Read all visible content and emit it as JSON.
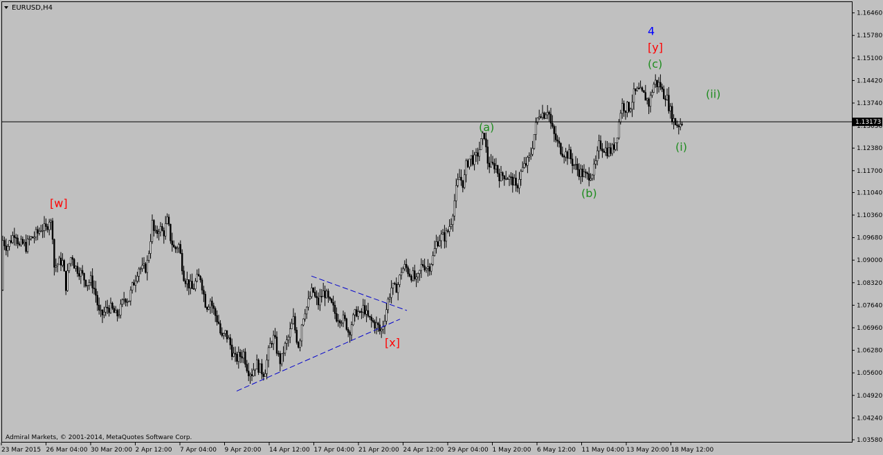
{
  "window": {
    "symbol_title": "EURUSD,H4",
    "copyright": "Admiral Markets, © 2001-2014, MetaQuotes Software Corp.",
    "menu_icon": "triangle-down-icon"
  },
  "colors": {
    "background": "#c0c0c0",
    "candle": "#000000",
    "wave_green": "#1e8c1e",
    "wave_red": "#ff0000",
    "wave_blue": "#0000ff",
    "trendline": "#0000cc"
  },
  "chart_data": {
    "type": "candlestick",
    "title": "EURUSD,H4",
    "ylim": [
      1.0358,
      1.1664
    ],
    "y_ticks": [
      "1.16460",
      "1.15780",
      "1.15100",
      "1.14420",
      "1.13740",
      "1.13056",
      "1.12380",
      "1.11700",
      "1.11040",
      "1.10360",
      "1.09680",
      "1.09000",
      "1.08320",
      "1.07640",
      "1.06960",
      "1.06280",
      "1.05600",
      "1.04920",
      "1.04240",
      "1.03580"
    ],
    "current_price": "1.13173",
    "x_ticks": [
      "23 Mar 2015",
      "26 Mar 04:00",
      "30 Mar 20:00",
      "2 Apr 12:00",
      "7 Apr 04:00",
      "9 Apr 20:00",
      "14 Apr 12:00",
      "17 Apr 04:00",
      "21 Apr 20:00",
      "24 Apr 12:00",
      "29 Apr 04:00",
      "1 May 20:00",
      "6 May 12:00",
      "11 May 04:00",
      "13 May 20:00",
      "18 May 12:00"
    ],
    "close_path": [
      [
        0,
        1.081
      ],
      [
        4,
        1.096
      ],
      [
        10,
        1.094
      ],
      [
        18,
        1.097
      ],
      [
        22,
        1.099
      ],
      [
        28,
        1.094
      ],
      [
        32,
        1.095
      ],
      [
        38,
        1.094
      ],
      [
        42,
        1.096
      ],
      [
        48,
        1.097
      ],
      [
        54,
        1.098
      ],
      [
        60,
        1.1
      ],
      [
        66,
        1.099
      ],
      [
        72,
        1.103
      ],
      [
        76,
        1.098
      ],
      [
        78,
        1.088
      ],
      [
        84,
        1.089
      ],
      [
        90,
        1.09
      ],
      [
        95,
        1.082
      ],
      [
        100,
        1.089
      ],
      [
        104,
        1.092
      ],
      [
        108,
        1.088
      ],
      [
        114,
        1.087
      ],
      [
        120,
        1.085
      ],
      [
        126,
        1.083
      ],
      [
        132,
        1.084
      ],
      [
        138,
        1.08
      ],
      [
        144,
        1.073
      ],
      [
        150,
        1.074
      ],
      [
        156,
        1.076
      ],
      [
        162,
        1.075
      ],
      [
        168,
        1.073
      ],
      [
        174,
        1.075
      ],
      [
        180,
        1.079
      ],
      [
        186,
        1.078
      ],
      [
        190,
        1.081
      ],
      [
        196,
        1.085
      ],
      [
        200,
        1.088
      ],
      [
        206,
        1.087
      ],
      [
        212,
        1.088
      ],
      [
        216,
        1.094
      ],
      [
        220,
        1.101
      ],
      [
        224,
        1.097
      ],
      [
        230,
        1.1
      ],
      [
        236,
        1.098
      ],
      [
        242,
        1.102
      ],
      [
        246,
        1.097
      ],
      [
        252,
        1.093
      ],
      [
        258,
        1.095
      ],
      [
        262,
        1.09
      ],
      [
        266,
        1.085
      ],
      [
        272,
        1.083
      ],
      [
        278,
        1.081
      ],
      [
        284,
        1.084
      ],
      [
        290,
        1.085
      ],
      [
        294,
        1.08
      ],
      [
        298,
        1.076
      ],
      [
        304,
        1.078
      ],
      [
        310,
        1.074
      ],
      [
        316,
        1.071
      ],
      [
        320,
        1.066
      ],
      [
        326,
        1.068
      ],
      [
        332,
        1.065
      ],
      [
        336,
        1.062
      ],
      [
        340,
        1.06
      ],
      [
        346,
        1.061
      ],
      [
        352,
        1.062
      ],
      [
        358,
        1.057
      ],
      [
        364,
        1.056
      ],
      [
        370,
        1.059
      ],
      [
        376,
        1.057
      ],
      [
        382,
        1.056
      ],
      [
        386,
        1.06
      ],
      [
        390,
        1.064
      ],
      [
        394,
        1.067
      ],
      [
        398,
        1.065
      ],
      [
        402,
        1.061
      ],
      [
        406,
        1.059
      ],
      [
        410,
        1.063
      ],
      [
        416,
        1.066
      ],
      [
        420,
        1.069
      ],
      [
        424,
        1.072
      ],
      [
        428,
        1.067
      ],
      [
        432,
        1.064
      ],
      [
        436,
        1.071
      ],
      [
        440,
        1.075
      ],
      [
        444,
        1.076
      ],
      [
        448,
        1.079
      ],
      [
        452,
        1.081
      ],
      [
        456,
        1.078
      ],
      [
        460,
        1.077
      ],
      [
        466,
        1.08
      ],
      [
        470,
        1.08
      ],
      [
        476,
        1.077
      ],
      [
        480,
        1.076
      ],
      [
        486,
        1.073
      ],
      [
        490,
        1.073
      ],
      [
        496,
        1.072
      ],
      [
        500,
        1.071
      ],
      [
        504,
        1.068
      ],
      [
        508,
        1.071
      ],
      [
        512,
        1.073
      ],
      [
        516,
        1.075
      ],
      [
        520,
        1.073
      ],
      [
        526,
        1.076
      ],
      [
        530,
        1.073
      ],
      [
        534,
        1.072
      ],
      [
        540,
        1.071
      ],
      [
        546,
        1.07
      ],
      [
        550,
        1.068
      ],
      [
        554,
        1.071
      ],
      [
        558,
        1.075
      ],
      [
        562,
        1.079
      ],
      [
        566,
        1.082
      ],
      [
        570,
        1.081
      ],
      [
        576,
        1.083
      ],
      [
        580,
        1.087
      ],
      [
        586,
        1.088
      ],
      [
        592,
        1.086
      ],
      [
        598,
        1.085
      ],
      [
        602,
        1.083
      ],
      [
        606,
        1.086
      ],
      [
        610,
        1.089
      ],
      [
        616,
        1.088
      ],
      [
        620,
        1.088
      ],
      [
        626,
        1.091
      ],
      [
        630,
        1.095
      ],
      [
        636,
        1.097
      ],
      [
        642,
        1.097
      ],
      [
        646,
        1.098
      ],
      [
        652,
        1.102
      ],
      [
        656,
        1.107
      ],
      [
        660,
        1.112
      ],
      [
        664,
        1.115
      ],
      [
        670,
        1.113
      ],
      [
        674,
        1.119
      ],
      [
        680,
        1.121
      ],
      [
        686,
        1.12
      ],
      [
        692,
        1.123
      ],
      [
        696,
        1.126
      ],
      [
        700,
        1.128
      ],
      [
        704,
        1.12
      ],
      [
        710,
        1.118
      ],
      [
        716,
        1.119
      ],
      [
        720,
        1.116
      ],
      [
        724,
        1.115
      ],
      [
        728,
        1.116
      ],
      [
        734,
        1.115
      ],
      [
        738,
        1.114
      ],
      [
        742,
        1.114
      ],
      [
        746,
        1.111
      ],
      [
        750,
        1.115
      ],
      [
        754,
        1.117
      ],
      [
        760,
        1.119
      ],
      [
        764,
        1.12
      ],
      [
        768,
        1.123
      ],
      [
        772,
        1.128
      ],
      [
        776,
        1.132
      ],
      [
        780,
        1.135
      ],
      [
        786,
        1.134
      ],
      [
        792,
        1.136
      ],
      [
        796,
        1.131
      ],
      [
        800,
        1.128
      ],
      [
        806,
        1.125
      ],
      [
        812,
        1.123
      ],
      [
        818,
        1.122
      ],
      [
        822,
        1.122
      ],
      [
        826,
        1.12
      ],
      [
        832,
        1.118
      ],
      [
        836,
        1.117
      ],
      [
        842,
        1.116
      ],
      [
        848,
        1.115
      ],
      [
        852,
        1.116
      ],
      [
        858,
        1.117
      ],
      [
        862,
        1.12
      ],
      [
        866,
        1.125
      ],
      [
        872,
        1.124
      ],
      [
        878,
        1.123
      ],
      [
        884,
        1.123
      ],
      [
        890,
        1.126
      ],
      [
        894,
        1.131
      ],
      [
        898,
        1.137
      ],
      [
        904,
        1.136
      ],
      [
        910,
        1.136
      ],
      [
        916,
        1.14
      ],
      [
        922,
        1.141
      ],
      [
        928,
        1.14
      ],
      [
        934,
        1.139
      ],
      [
        938,
        1.137
      ],
      [
        942,
        1.141
      ],
      [
        946,
        1.144
      ],
      [
        950,
        1.143
      ],
      [
        954,
        1.143
      ],
      [
        958,
        1.14
      ],
      [
        962,
        1.14
      ],
      [
        966,
        1.137
      ],
      [
        970,
        1.134
      ],
      [
        974,
        1.132
      ],
      [
        978,
        1.131
      ],
      [
        982,
        1.131
      ],
      [
        986,
        1.132
      ]
    ],
    "annotations": [
      {
        "text": "[w]",
        "color": "red",
        "x": 72,
        "y": 1.106
      },
      {
        "text": "[x]",
        "color": "red",
        "x": 556,
        "y": 1.064
      },
      {
        "text": "4",
        "color": "blue",
        "x": 936,
        "y": 1.158
      },
      {
        "text": "[y]",
        "color": "red",
        "x": 936,
        "y": 1.153
      },
      {
        "text": "(c)",
        "color": "green",
        "x": 936,
        "y": 1.148
      },
      {
        "text": "(a)",
        "color": "green",
        "x": 692,
        "y": 1.129
      },
      {
        "text": "(b)",
        "color": "green",
        "x": 840,
        "y": 1.109
      },
      {
        "text": "(i)",
        "color": "green",
        "x": 976,
        "y": 1.123
      },
      {
        "text": "(ii)",
        "color": "green",
        "x": 1020,
        "y": 1.139
      }
    ],
    "trendlines": [
      {
        "from": [
          342,
          1.0505
        ],
        "to": [
          578,
          1.0722
        ]
      },
      {
        "from": [
          450,
          1.0852
        ],
        "to": [
          588,
          1.0748
        ]
      }
    ]
  }
}
